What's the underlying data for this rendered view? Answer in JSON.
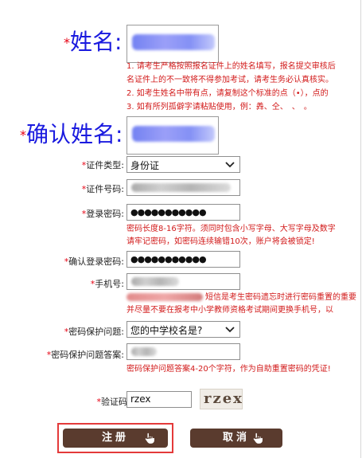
{
  "form": {
    "name": {
      "star": "*",
      "label": "姓名:"
    },
    "name_notes": [
      "1. 请考生严格按照报名证件上的姓名填写，报名提交审核后",
      "名证件上的不一致将不得参加考试，请考生务必认真核实。",
      "2. 如考生姓名中带有点，请复制这个标准的点（•），点的",
      "3. 如有所列孤僻字请粘贴使用，例：羴、仝、　、　。"
    ],
    "confirm_name": {
      "star": "*",
      "label": "确认姓名:"
    },
    "id_type": {
      "star": "*",
      "label": "证件类型:",
      "value": "身份证"
    },
    "id_number": {
      "star": "*",
      "label": "证件号码:"
    },
    "password": {
      "star": "*",
      "label": "登录密码:",
      "value": "●●●●●●●●●●●"
    },
    "password_notes": [
      "密码长度8-16字符。须同时包含小写字母、大写字母及数字",
      "请牢记密码，如密码连续输错10次，账户将会被锁定!"
    ],
    "confirm_password": {
      "star": "*",
      "label": "确认登录密码:",
      "value": "●●●●●●●●●●●"
    },
    "phone": {
      "star": "*",
      "label": "手机号:"
    },
    "phone_notes": [
      "短信是考生密码遗忘时进行密码重置的重要",
      "并尽量不要在报考中小学教师资格考试期间更换手机号，以"
    ],
    "security_question": {
      "star": "*",
      "label": "密码保护问题:",
      "value": "您的中学校名是?"
    },
    "security_answer": {
      "star": "*",
      "label": "密码保护问题答案:"
    },
    "answer_note": "密码保护问题答案4-20个字符，作为自助重置密码的凭证!",
    "captcha": {
      "star": "*",
      "label": "验证码",
      "value": "rzex",
      "image_text": "rzex"
    }
  },
  "buttons": {
    "register": "注册",
    "cancel": "取消"
  },
  "colors": {
    "label_blue": "#1a1adf",
    "required_red": "#e60012",
    "note_red": "#d21a1a",
    "button_brown": "#5a3b2e",
    "focus_red": "#e43a3a"
  }
}
